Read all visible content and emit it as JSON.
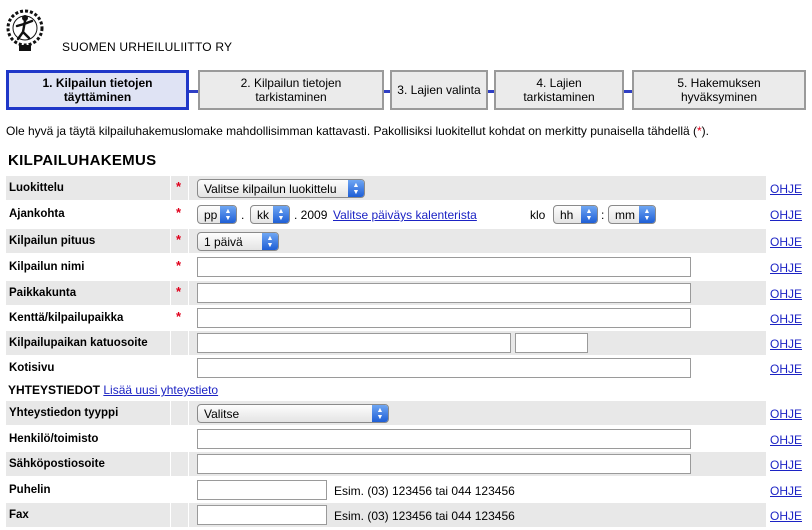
{
  "header": {
    "org_name": "SUOMEN URHEILULIITTO RY"
  },
  "steps": [
    {
      "label": "1. Kilpailun tietojen täyttäminen",
      "active": true
    },
    {
      "label": "2. Kilpailun tietojen tarkistaminen",
      "active": false
    },
    {
      "label": "3. Lajien valinta",
      "active": false
    },
    {
      "label": "4. Lajien tarkistaminen",
      "active": false
    },
    {
      "label": "5. Hakemuksen hyväksyminen",
      "active": false
    }
  ],
  "intro": {
    "text_before": "Ole hyvä ja täytä kilpailuhakemuslomake mahdollisimman kattavasti. Pakollisiksi luokitellut kohdat on merkitty punaisella tähdellä (",
    "star": "*",
    "text_after": ")."
  },
  "form_title": "KILPAILUHAKEMUS",
  "help_label": "OHJE",
  "required_mark": "*",
  "rows": {
    "luokittelu": {
      "label": "Luokittelu",
      "select": "Valitse kilpailun luokittelu"
    },
    "ajankohta": {
      "label": "Ajankohta",
      "day": "pp",
      "sep1": ".",
      "month": "kk",
      "sep2": ". 2009",
      "calendar_link": "Valitse päiväys kalenterista",
      "klo": "klo",
      "hour": "hh",
      "colon": ":",
      "minute": "mm"
    },
    "pituus": {
      "label": "Kilpailun pituus",
      "select": "1 päivä"
    },
    "nimi": {
      "label": "Kilpailun nimi",
      "value": ""
    },
    "paikkakunta": {
      "label": "Paikkakunta",
      "value": ""
    },
    "kentta": {
      "label": "Kenttä/kilpailupaikka",
      "value": ""
    },
    "katuosoite": {
      "label": "Kilpailupaikan katuosoite",
      "value": "",
      "postal": ""
    },
    "kotisivu": {
      "label": "Kotisivu",
      "value": ""
    }
  },
  "contact_section": {
    "title": "YHTEYSTIEDOT",
    "add_link": "Lisää uusi yhteystieto"
  },
  "contact": {
    "tyyppi": {
      "label": "Yhteystiedon tyyppi",
      "select": "Valitse"
    },
    "henkilo": {
      "label": "Henkilö/toimisto",
      "value": ""
    },
    "email": {
      "label": "Sähköpostiosoite",
      "value": ""
    },
    "puhelin": {
      "label": "Puhelin",
      "value": "",
      "example": "Esim. (03) 123456 tai 044 123456"
    },
    "fax": {
      "label": "Fax",
      "value": "",
      "example": "Esim. (03) 123456 tai 044 123456"
    }
  }
}
